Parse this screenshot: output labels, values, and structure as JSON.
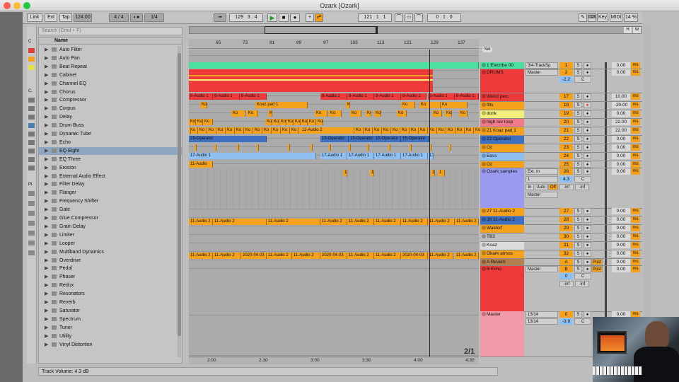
{
  "window": {
    "title": "Ozark  [Ozark]"
  },
  "transport": {
    "link": "Link",
    "ext": "Ext",
    "tap": "Tap",
    "tempo": "124.00",
    "signature": "4 / 4",
    "quant": "1/4",
    "position": "129 .  3 .  4",
    "loop_start": "121 .  1 .  1",
    "loop_len": "0 .  1 .  0",
    "key": "Key",
    "midi": "MIDI",
    "cpu": "14 %",
    "d": "D"
  },
  "browser": {
    "search_placeholder": "Search (Cmd + F)",
    "header": "Name",
    "items": [
      "Auto Filter",
      "Auto Pan",
      "Beat Repeat",
      "Cabinet",
      "Channel EQ",
      "Chorus",
      "Compressor",
      "Corpus",
      "Delay",
      "Drum Buss",
      "Dynamic Tube",
      "Echo",
      "EQ Eight",
      "EQ Three",
      "Erosion",
      "External Audio Effect",
      "Filter Delay",
      "Flanger",
      "Frequency Shifter",
      "Gate",
      "Glue Compressor",
      "Grain Delay",
      "Limiter",
      "Looper",
      "Multiband Dynamics",
      "Overdrive",
      "Pedal",
      "Phaser",
      "Redux",
      "Resonators",
      "Reverb",
      "Saturator",
      "Spectrum",
      "Tuner",
      "Utility",
      "Vinyl Distortion"
    ],
    "selected": "EQ Eight",
    "side_labels": {
      "c": "C.",
      "pl": "Pl."
    }
  },
  "ruler": {
    "bars": [
      "65",
      "73",
      "81",
      "89",
      "97",
      "105",
      "113",
      "121",
      "129",
      "137"
    ],
    "times": [
      "2:00",
      "2:30",
      "3:00",
      "3:30",
      "4:00",
      "4:30"
    ]
  },
  "page_indicator": "2/1",
  "overview": {
    "h": "H",
    "w": "W",
    "set": "Set"
  },
  "clips": {
    "a8": "8-Audio 1",
    "koaz": "Koaz pad 1",
    "ko": "Ko",
    "kos": "Koz",
    "op": "15-Operator",
    "a17": "17-Audio 1",
    "a11": "11-Audio",
    "a11b": "11-Audio 2",
    "date": "2020-04-03",
    "one": "1"
  },
  "tracks": [
    {
      "name": "1 Elecribe 00",
      "num": "1",
      "route": "3/4-TrackSp",
      "vol": "0.00",
      "ms": "ms",
      "color": "#4be0a0"
    },
    {
      "name": "DRUMS",
      "num": "2",
      "route": "Master",
      "vol": "0.00",
      "ms": "ms",
      "color": "#ee3a3a",
      "pan": "-2.2",
      "panc": "C"
    },
    {
      "name": "Weird perc",
      "num": "17",
      "route": "",
      "vol": "10.00",
      "ms": "ms",
      "color": "#ee3a3a"
    },
    {
      "name": "fills",
      "num": "18",
      "route": "",
      "vol": "-20.00",
      "ms": "ms",
      "color": "#f4a21e"
    },
    {
      "name": "donk",
      "num": "19",
      "route": "",
      "vol": "0.00",
      "ms": "ms",
      "color": "#f2f07a"
    },
    {
      "name": "high rev loop",
      "num": "20",
      "route": "",
      "vol": "22.00",
      "ms": "ms",
      "color": "#f07a8a"
    },
    {
      "name": "21 Koaz pad 1",
      "num": "21",
      "route": "",
      "vol": "22.00",
      "ms": "ms",
      "color": "#f4a21e"
    },
    {
      "name": "22 Operator",
      "num": "22",
      "route": "",
      "vol": "0.00",
      "ms": "ms",
      "color": "#3f6fc0"
    },
    {
      "name": "Oz",
      "num": "23",
      "route": "",
      "vol": "0.00",
      "ms": "ms",
      "color": "#f4a21e"
    },
    {
      "name": "Bass",
      "num": "24",
      "route": "",
      "vol": "0.00",
      "ms": "ms",
      "color": "#8fc0f4"
    },
    {
      "name": "Oz",
      "num": "25",
      "route": "",
      "vol": "0.00",
      "ms": "ms",
      "color": "#f4a21e"
    },
    {
      "name": "Ozark samples",
      "num": "26",
      "route": "Ext. In",
      "vol": "0.00",
      "ms": "ms",
      "color": "#9a9af0",
      "in": "In",
      "auto": "Auto",
      "off": "Off",
      "ch": "1",
      "sendval": "4.3",
      "c": "C",
      "inf1": "-inf",
      "inf2": "-inf",
      "master": "Master"
    },
    {
      "name": "27 11-Audio 2",
      "num": "27",
      "route": "",
      "vol": "0.00",
      "ms": "ms",
      "color": "#f4a21e"
    },
    {
      "name": "28 11-Audio 2",
      "num": "28",
      "route": "",
      "vol": "0.00",
      "ms": "ms",
      "color": "#3f6fc0"
    },
    {
      "name": "Waldorf",
      "num": "29",
      "route": "",
      "vol": "0.00",
      "ms": "ms",
      "color": "#f4a21e"
    },
    {
      "name": "TB3",
      "num": "30",
      "route": "",
      "vol": "0.00",
      "ms": "ms",
      "color": "#bdbdbd"
    },
    {
      "name": "Koaz",
      "num": "31",
      "route": "",
      "vol": "0.00",
      "ms": "ms",
      "color": "#dcdcdc"
    },
    {
      "name": "Okark atmos",
      "num": "32",
      "route": "",
      "vol": "0.00",
      "ms": "ms",
      "color": "#f4a21e"
    },
    {
      "name": "A Reverb",
      "num": "A",
      "route": "",
      "vol": "0.00",
      "ms": "ms",
      "color": "#b48050",
      "post": "Post"
    },
    {
      "name": "B Echo",
      "num": "B",
      "route": "Master",
      "vol": "0.00",
      "ms": "ms",
      "color": "#ee3a3a",
      "post": "Post",
      "zero": "0",
      "c": "C",
      "inf1": "-inf",
      "inf2": "-inf"
    },
    {
      "name": "Master",
      "num": "0",
      "route": "13/14",
      "route2": "13/14",
      "vol": "0.00",
      "ms": "ms",
      "color": "#f29aa8",
      "pan": "-3.9",
      "c": "C"
    }
  ],
  "mixer_buttons": {
    "s": "S",
    "solo_dot": "●"
  },
  "status": {
    "text": "Track Volume: 4.3 dB"
  },
  "colors": {
    "orange": "#f4a21e",
    "blue": "#3f6fc0",
    "red": "#ee3a3a",
    "green": "#4be0a0",
    "light_blue": "#8fc0f4"
  }
}
